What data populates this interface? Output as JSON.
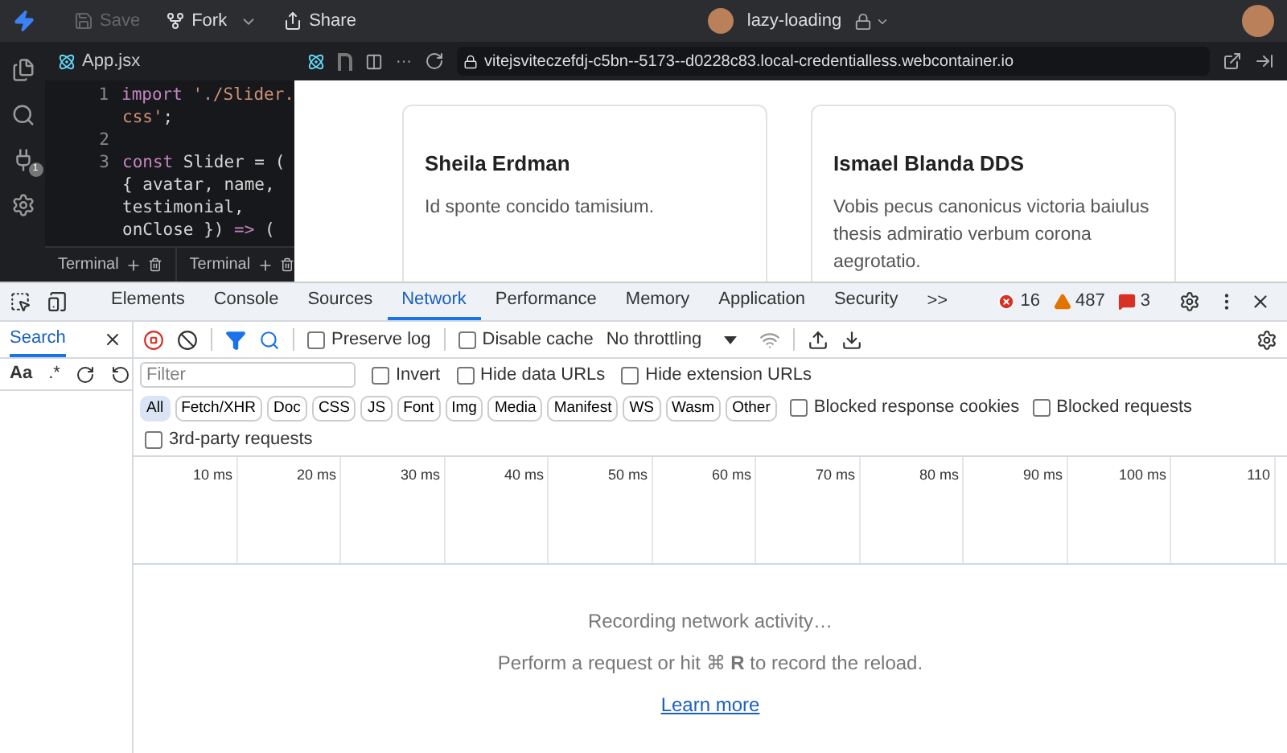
{
  "top_bar": {
    "save": {
      "label": "Save",
      "disabled": true
    },
    "fork": "Fork",
    "share": "Share",
    "project": "lazy-loading"
  },
  "activity_bar": {
    "extensions_badge": "1"
  },
  "editor_tab": "App.jsx",
  "preview_bar": {
    "more": "···",
    "url": "vitejsviteczefdj-c5bn--5173--d0228c83.local-credentialless.webcontainer.io"
  },
  "code_lines": [
    {
      "number": "1",
      "tokens": [
        {
          "kind": "keyword",
          "text": "import"
        },
        {
          "kind": "string",
          "text": " './Slider."
        }
      ]
    },
    {
      "tokens": [
        {
          "kind": "string",
          "text": "css'"
        },
        {
          "kind": "plain",
          "text": ";"
        }
      ]
    },
    {
      "number": "2"
    },
    {
      "number": "3",
      "tokens": [
        {
          "kind": "keyword",
          "text": "const"
        },
        {
          "kind": "plain",
          "text": " Slider = ("
        }
      ]
    },
    {
      "tokens": [
        {
          "kind": "plain",
          "text": "{ avatar, name,"
        }
      ]
    },
    {
      "tokens": [
        {
          "kind": "plain",
          "text": "testimonial,"
        }
      ]
    },
    {
      "tokens": [
        {
          "kind": "plain",
          "text": "onClose }) "
        },
        {
          "kind": "keyword",
          "text": "=>"
        },
        {
          "kind": "plain",
          "text": " ("
        }
      ]
    }
  ],
  "terminals": [
    "Terminal",
    "Terminal"
  ],
  "cards": [
    {
      "name": "Sheila Erdman",
      "text": "Id sponte concido tamisium."
    },
    {
      "name": "Ismael Blanda DDS",
      "text": "Vobis pecus canonicus victoria baiulus thesis admiratio verbum corona aegrotatio."
    }
  ],
  "devtools": {
    "tabs": [
      {
        "label": "Elements",
        "selected": false
      },
      {
        "label": "Console",
        "selected": false
      },
      {
        "label": "Sources",
        "selected": false
      },
      {
        "label": "Network",
        "selected": true
      },
      {
        "label": "Performance",
        "selected": false
      },
      {
        "label": "Memory",
        "selected": false
      },
      {
        "label": "Application",
        "selected": false
      },
      {
        "label": "Security",
        "selected": false
      }
    ],
    "more_tabs": ">>",
    "counts": {
      "errors": "16",
      "warnings": "487",
      "issues": "3"
    },
    "search_panel": {
      "tab": "Search",
      "case": "Aa",
      "regex": ".*"
    },
    "toolbar": {
      "recording": true,
      "preserve_log": {
        "label": "Preserve log",
        "checked": false
      },
      "disable_cache": {
        "label": "Disable cache",
        "checked": false
      },
      "throttling": "No throttling"
    },
    "filter": {
      "placeholder": "Filter"
    },
    "filter_options": [
      {
        "label": "Invert",
        "checked": false
      },
      {
        "label": "Hide data URLs",
        "checked": false
      },
      {
        "label": "Hide extension URLs",
        "checked": false
      }
    ],
    "types": [
      {
        "label": "All",
        "selected": true
      },
      {
        "label": "Fetch/XHR",
        "selected": false
      },
      {
        "label": "Doc",
        "selected": false
      },
      {
        "label": "CSS",
        "selected": false
      },
      {
        "label": "JS",
        "selected": false
      },
      {
        "label": "Font",
        "selected": false
      },
      {
        "label": "Img",
        "selected": false
      },
      {
        "label": "Media",
        "selected": false
      },
      {
        "label": "Manifest",
        "selected": false
      },
      {
        "label": "WS",
        "selected": false
      },
      {
        "label": "Wasm",
        "selected": false
      },
      {
        "label": "Other",
        "selected": false
      }
    ],
    "blocked_options": [
      {
        "label": "Blocked response cookies",
        "checked": false
      },
      {
        "label": "Blocked requests",
        "checked": false
      }
    ],
    "third_party": {
      "label": "3rd-party requests",
      "checked": false
    },
    "timeline_ticks": [
      "10 ms",
      "20 ms",
      "30 ms",
      "40 ms",
      "50 ms",
      "60 ms",
      "70 ms",
      "80 ms",
      "90 ms",
      "100 ms",
      "110"
    ],
    "empty_state": {
      "title": "Recording network activity…",
      "hint": "Perform a request or hit ⌘ **R** to record the reload.",
      "link": "Learn more"
    }
  }
}
